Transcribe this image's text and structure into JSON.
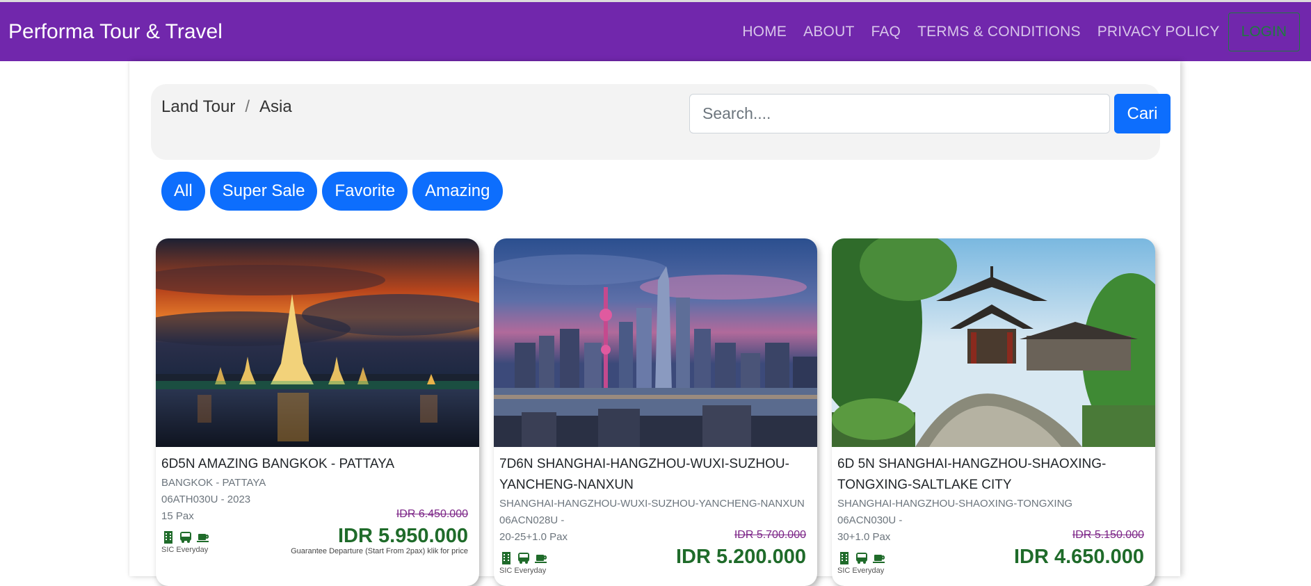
{
  "nav": {
    "brand": "Performa Tour & Travel",
    "links": [
      "HOME",
      "ABOUT",
      "FAQ",
      "TERMS & CONDITIONS",
      "PRIVACY POLICY"
    ],
    "login": "LOGIN"
  },
  "search": {
    "breadcrumb": [
      "Land Tour",
      "Asia"
    ],
    "separator": "/",
    "placeholder": "Search....",
    "button": "Cari"
  },
  "filters": [
    "All",
    "Super Sale",
    "Favorite",
    "Amazing"
  ],
  "cards": [
    {
      "title": "6D5N AMAZING BANGKOK - PATTAYA",
      "route": "BANGKOK - PATTAYA",
      "code": "06ATH030U - 2023",
      "pax": "15 Pax",
      "old_price": "IDR 6.450.000",
      "new_price": "IDR 5.950.000",
      "sic": "SIC Everyday",
      "note": "Guarantee Departure (Start From 2pax) klik for price",
      "image": "bangkok-temple-photo"
    },
    {
      "title": "7D6N SHANGHAI-HANGZHOU-WUXI-SUZHOU-YANCHENG-NANXUN",
      "route": "SHANGHAI-HANGZHOU-WUXI-SUZHOU-YANCHENG-NANXUN",
      "code": "06ACN028U -",
      "pax": "20-25+1.0 Pax",
      "old_price": "IDR 5.700.000",
      "new_price": "IDR 5.200.000",
      "sic": "SIC Everyday",
      "image": "shanghai-skyline-photo"
    },
    {
      "title": "6D 5N SHANGHAI-HANGZHOU-SHAOXING-TONGXING-SALTLAKE CITY",
      "route": "SHANGHAI-HANGZHOU-SHAOXING-TONGXING",
      "code": "06ACN030U -",
      "pax": "30+1.0 Pax",
      "old_price": "IDR 5.150.000",
      "new_price": "IDR 4.650.000",
      "sic": "SIC Everyday",
      "image": "chinese-pavilion-photo"
    }
  ],
  "colors": {
    "navbar": "#7127ac",
    "primary": "#0d6efd",
    "price": "#1f6b2a",
    "old_price": "#7b2386"
  },
  "icons": [
    "building-icon",
    "bus-icon",
    "coffee-icon"
  ]
}
